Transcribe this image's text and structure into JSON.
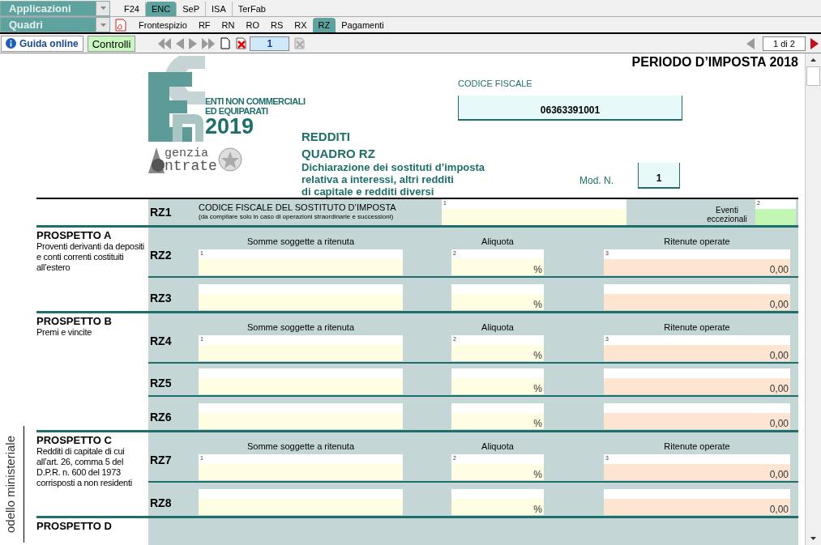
{
  "toolbar": {
    "dropdowns": [
      {
        "label": "Applicazioni"
      },
      {
        "label": "Quadri"
      }
    ],
    "app_tabs": [
      {
        "label": "F24",
        "selected": false
      },
      {
        "label": "ENC",
        "selected": true
      },
      {
        "label": "SeP",
        "selected": false
      },
      {
        "label": "ISA",
        "selected": false
      },
      {
        "label": "TerFab",
        "selected": false
      }
    ],
    "quadri_tabs": [
      {
        "label": "Frontespizio",
        "selected": false
      },
      {
        "label": "RF",
        "selected": false
      },
      {
        "label": "RN",
        "selected": false
      },
      {
        "label": "RO",
        "selected": false
      },
      {
        "label": "RS",
        "selected": false
      },
      {
        "label": "RX",
        "selected": false
      },
      {
        "label": "RZ",
        "selected": true
      },
      {
        "label": "Pagamenti",
        "selected": false
      }
    ],
    "guide_button": "Guida online",
    "check_button": "Controlli",
    "page_field": "1",
    "pager": "1 di 2"
  },
  "form": {
    "period": "PERIODO D’IMPOSTA 2018",
    "logo": {
      "line1": "ENTI NON COMMERCIALI",
      "line2": "ED EQUIPARATI",
      "year": "2019"
    },
    "agency": {
      "line1": "genzia",
      "line2": "ntrate"
    },
    "title": "REDDITI",
    "subtitle": "QUADRO RZ",
    "description": [
      "Dichiarazione dei sostituti d’imposta",
      "relativa a interessi, altri redditi",
      "di capitale e redditi diversi"
    ],
    "codice_fiscale": {
      "label": "CODICE FISCALE",
      "value": "06363391001"
    },
    "mod_n": {
      "label": "Mod. N.",
      "value": "1"
    },
    "side_label": "odello ministeriale",
    "rz1": {
      "code": "RZ1",
      "title": "CODICE FISCALE DEL SOSTITUTO D’IMPOSTA",
      "note": "(da compilare solo in caso di operazioni straordinarie e successioni)",
      "field_index": "1",
      "flag_label": "Eventi eccezionali",
      "flag_index": "2"
    },
    "prospetti": [
      {
        "title": "PROSPETTO A",
        "description": "Proventi derivanti da depositi e conti correnti costituiti all’estero",
        "headers": [
          "Somme soggette a ritenuta",
          "Aliquota",
          "Ritenute operate"
        ],
        "rows": [
          {
            "code": "RZ2",
            "indices": [
              "1",
              "2",
              "3"
            ],
            "aliquota": "%",
            "ritenute": "0,00"
          },
          {
            "code": "RZ3",
            "aliquota": "%",
            "ritenute": "0,00"
          }
        ]
      },
      {
        "title": "PROSPETTO B",
        "description": "Premi e vincite",
        "headers": [
          "Somme soggette a ritenuta",
          "Aliquota",
          "Ritenute operate"
        ],
        "rows": [
          {
            "code": "RZ4",
            "indices": [
              "1",
              "2",
              "3"
            ],
            "aliquota": "%",
            "ritenute": "0,00"
          },
          {
            "code": "RZ5",
            "aliquota": "%",
            "ritenute": "0,00"
          },
          {
            "code": "RZ6",
            "aliquota": "%",
            "ritenute": "0,00"
          }
        ]
      },
      {
        "title": "PROSPETTO C",
        "description": "Redditi di capitale di cui all’art. 26, comma 5 del D.P.R. n. 600 del 1973 corrisposti a non residenti",
        "headers": [
          "Somme soggette a ritenuta",
          "Aliquota",
          "Ritenute operate"
        ],
        "rows": [
          {
            "code": "RZ7",
            "indices": [
              "1",
              "2",
              "3"
            ],
            "aliquota": "%",
            "ritenute": "0,00"
          },
          {
            "code": "RZ8",
            "aliquota": "%",
            "ritenute": "0,00"
          }
        ]
      },
      {
        "title": "PROSPETTO D"
      }
    ]
  }
}
